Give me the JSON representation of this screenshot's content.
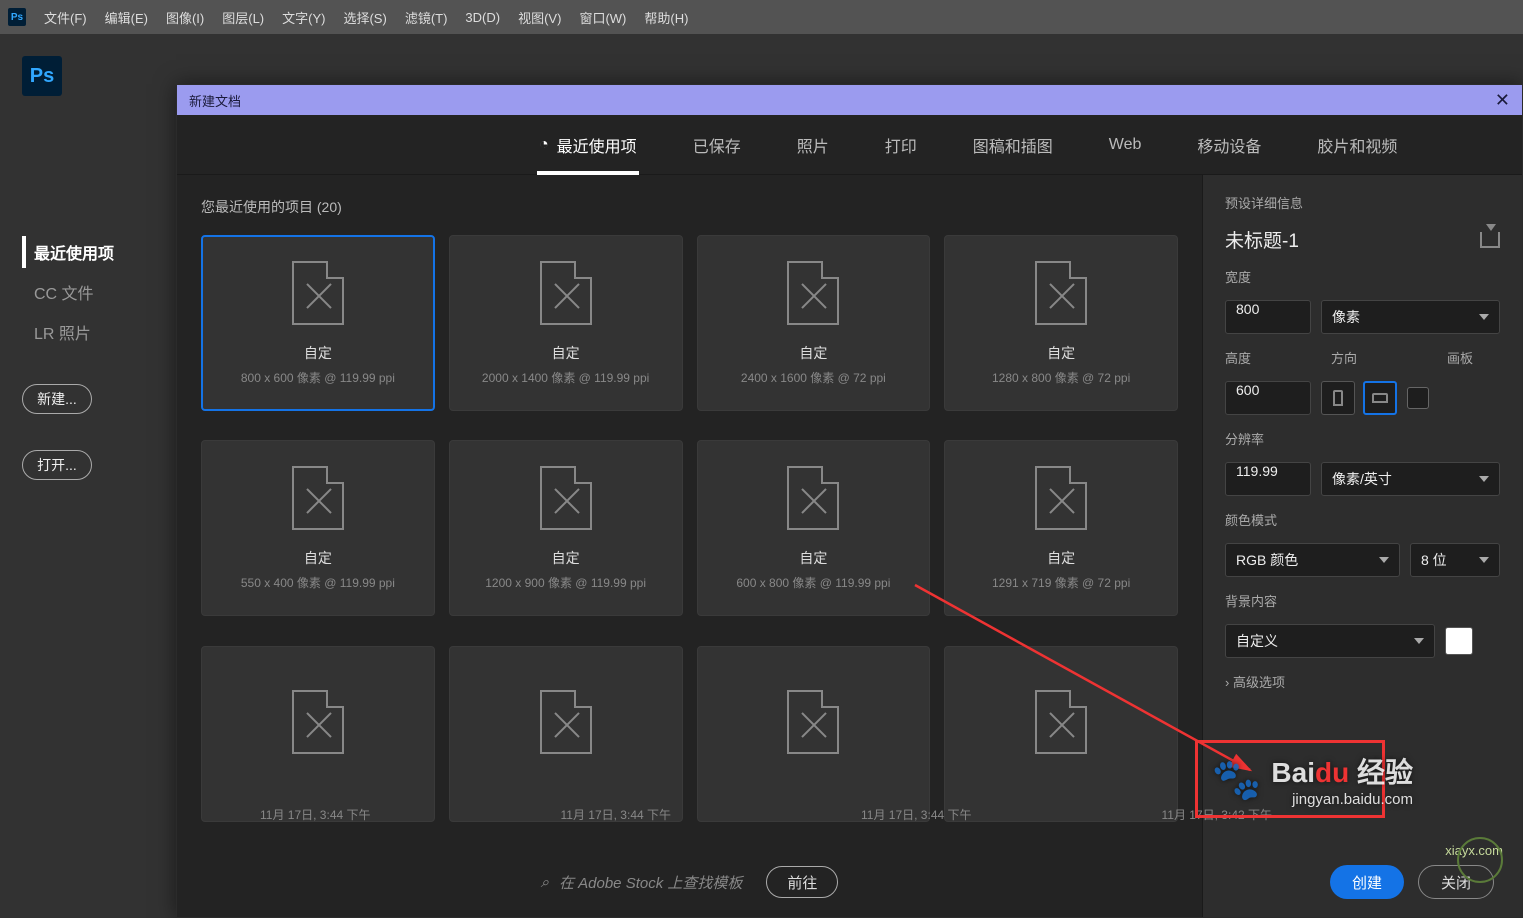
{
  "menubar": {
    "items": [
      "文件(F)",
      "编辑(E)",
      "图像(I)",
      "图层(L)",
      "文字(Y)",
      "选择(S)",
      "滤镜(T)",
      "3D(D)",
      "视图(V)",
      "窗口(W)",
      "帮助(H)"
    ]
  },
  "leftnav": {
    "items": [
      {
        "label": "最近使用项",
        "active": true
      },
      {
        "label": "CC 文件",
        "active": false
      },
      {
        "label": "LR 照片",
        "active": false
      }
    ],
    "new_btn": "新建...",
    "open_btn": "打开..."
  },
  "dialog": {
    "title": "新建文档",
    "close": "✕",
    "tabs": [
      {
        "label": "最近使用项",
        "active": true,
        "icon": "clock"
      },
      {
        "label": "已保存"
      },
      {
        "label": "照片"
      },
      {
        "label": "打印"
      },
      {
        "label": "图稿和插图"
      },
      {
        "label": "Web"
      },
      {
        "label": "移动设备"
      },
      {
        "label": "胶片和视频"
      }
    ],
    "grid_label": "您最近使用的项目  (20)",
    "presets": [
      {
        "name": "自定",
        "spec": "800 x 600 像素 @ 119.99 ppi",
        "selected": true
      },
      {
        "name": "自定",
        "spec": "2000 x 1400 像素 @ 119.99 ppi"
      },
      {
        "name": "自定",
        "spec": "2400 x 1600 像素 @ 72 ppi"
      },
      {
        "name": "自定",
        "spec": "1280 x 800 像素 @ 72 ppi"
      },
      {
        "name": "自定",
        "spec": "550 x 400 像素 @ 119.99 ppi"
      },
      {
        "name": "自定",
        "spec": "1200 x 900 像素 @ 119.99 ppi"
      },
      {
        "name": "自定",
        "spec": "600 x 800 像素 @ 119.99 ppi"
      },
      {
        "name": "自定",
        "spec": "1291 x 719 像素 @ 72 ppi"
      },
      {
        "name": "",
        "spec": ""
      },
      {
        "name": "",
        "spec": ""
      },
      {
        "name": "",
        "spec": ""
      },
      {
        "name": "",
        "spec": ""
      }
    ],
    "search": {
      "placeholder": "在 Adobe Stock 上查找模板",
      "go": "前往"
    }
  },
  "settings": {
    "title": "预设详细信息",
    "docname": "未标题-1",
    "width_label": "宽度",
    "width": "800",
    "width_unit": "像素",
    "height_label": "高度",
    "height": "600",
    "orient_label": "方向",
    "artboard_label": "画板",
    "res_label": "分辨率",
    "res": "119.99",
    "res_unit": "像素/英寸",
    "color_label": "颜色模式",
    "color_mode": "RGB 颜色",
    "depth": "8 位",
    "bg_label": "背景内容",
    "bg": "自定义",
    "bg_color": "#ffffff",
    "advanced": "高级选项",
    "create": "创建",
    "close_btn": "关闭"
  },
  "timeline": {
    "t": "11月 17日, 3:44 下午",
    "t2": "11月 17日, 3:42 下午"
  },
  "watermarks": {
    "baidu": "Bai",
    "du": "du",
    "jy": "经验",
    "url": "jingyan.baidu.com",
    "xia": "xiayx.com"
  }
}
